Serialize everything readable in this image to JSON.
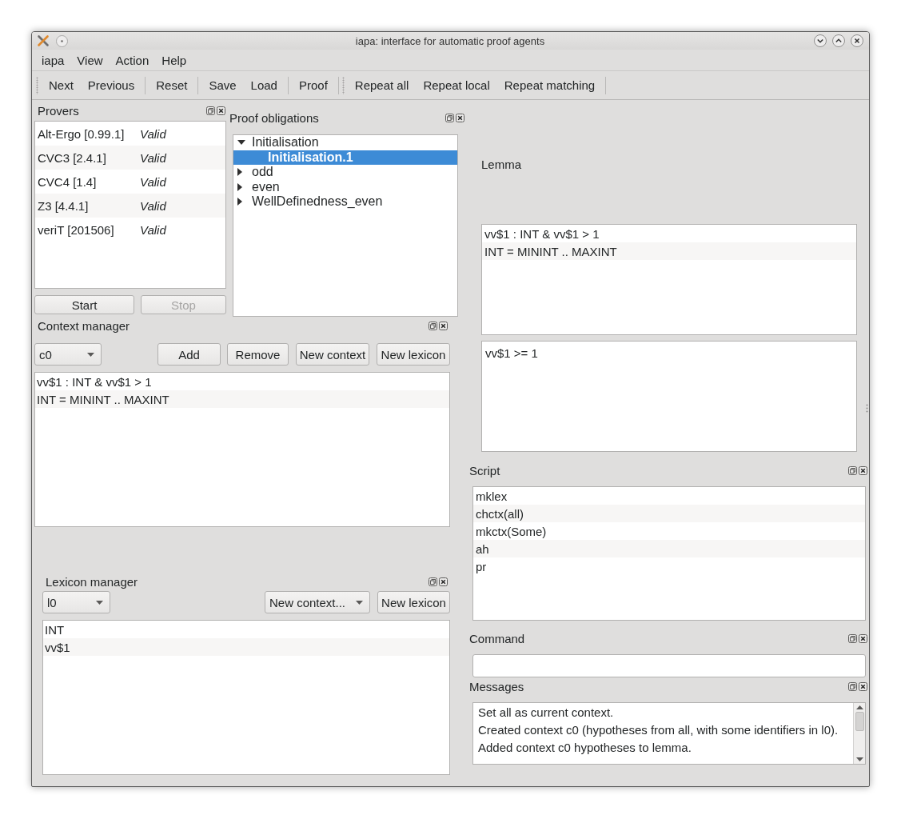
{
  "window": {
    "title": "iapa: interface for automatic proof agents"
  },
  "menu": [
    "iapa",
    "View",
    "Action",
    "Help"
  ],
  "toolbars": [
    {
      "groups": [
        [
          "Next",
          "Previous"
        ],
        [
          "Reset"
        ],
        [
          "Save",
          "Load"
        ],
        [
          "Proof"
        ]
      ]
    },
    {
      "groups": [
        [
          "Repeat all",
          "Repeat local",
          "Repeat matching"
        ]
      ]
    }
  ],
  "provers": {
    "title": "Provers",
    "rows": [
      {
        "name": "Alt-Ergo [0.99.1]",
        "status": "Valid"
      },
      {
        "name": "CVC3 [2.4.1]",
        "status": "Valid"
      },
      {
        "name": "CVC4 [1.4]",
        "status": "Valid"
      },
      {
        "name": "Z3 [4.4.1]",
        "status": "Valid"
      },
      {
        "name": "veriT [201506]",
        "status": "Valid"
      }
    ],
    "buttons": [
      {
        "label": "Start",
        "disabled": false
      },
      {
        "label": "Stop",
        "disabled": true
      }
    ]
  },
  "proof_obligations": {
    "title": "Proof obligations",
    "tree": [
      {
        "label": "Initialisation",
        "expanded": true,
        "selected": false,
        "children": [
          {
            "label": "Initialisation.1",
            "selected": true
          }
        ]
      },
      {
        "label": "odd",
        "expanded": false,
        "selected": false
      },
      {
        "label": "even",
        "expanded": false,
        "selected": false
      },
      {
        "label": "WellDefinedness_even",
        "expanded": false,
        "selected": false
      }
    ]
  },
  "context_manager": {
    "title": "Context manager",
    "context_select": "c0",
    "buttons": [
      "Add",
      "Remove",
      "New context",
      "New lexicon"
    ],
    "hypotheses": [
      "vv$1 : INT & vv$1 > 1",
      "INT = MININT .. MAXINT"
    ]
  },
  "lexicon_manager": {
    "title": "Lexicon manager",
    "lexicon_select": "l0",
    "new_context_select": "New context...",
    "new_lexicon_button": "New lexicon",
    "identifiers": [
      "INT",
      "vv$1"
    ]
  },
  "lemma": {
    "label": "Lemma",
    "hypotheses": [
      "vv$1 : INT & vv$1 > 1",
      "INT = MININT .. MAXINT"
    ],
    "goal": "vv$1 >= 1"
  },
  "script": {
    "title": "Script",
    "lines": [
      "mklex",
      "chctx(all)",
      "mkctx(Some)",
      "ah",
      "pr"
    ]
  },
  "command": {
    "title": "Command"
  },
  "messages": {
    "title": "Messages",
    "lines": [
      "Set all as current context.",
      "Created context c0 (hypotheses from all, with some identifiers in l0).",
      "Added context c0 hypotheses to lemma."
    ]
  }
}
